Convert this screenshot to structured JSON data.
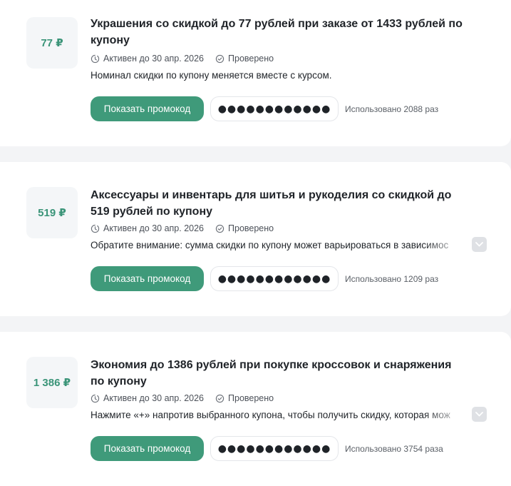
{
  "coupons": [
    {
      "amount": "77 ₽",
      "title": "Украшения со скидкой до 77 рублей при заказе от 1433 рублей по купону",
      "active": "Активен до 30 апр. 2026",
      "verified": "Проверено",
      "description": "Номинал скидки по купону меняется вместе с курсом.",
      "button": "Показать промокод",
      "code_mask": "●●●●●●●●●●●●",
      "used": "Использовано 2088 раз"
    },
    {
      "amount": "519 ₽",
      "title": "Аксессуары и инвентарь для шитья и рукоделия со скидкой до 519 рублей по купону",
      "active": "Активен до 30 апр. 2026",
      "verified": "Проверено",
      "description": "Обратите внимание: сумма скидки по купону может варьироваться в зависимос",
      "button": "Показать промокод",
      "code_mask": "●●●●●●●●●●●●",
      "used": "Использовано 1209 раз"
    },
    {
      "amount": "1 386 ₽",
      "title": "Экономия до 1386 рублей при покупке кроссовок и снаряжения по купону",
      "active": "Активен до 30 апр. 2026",
      "verified": "Проверено",
      "description": "Нажмите «+» напротив выбранного купона, чтобы получить скидку, которая мож",
      "button": "Показать промокод",
      "code_mask": "●●●●●●●●●●●●",
      "used": "Использовано 3754 раза"
    }
  ],
  "icons": {
    "active": "clock-icon",
    "verified": "check-circle-icon",
    "expand": "chevron-down-icon"
  },
  "colors": {
    "accent": "#3f9a7a",
    "amount_text": "#3a9478",
    "background": "#f3f4f6"
  }
}
